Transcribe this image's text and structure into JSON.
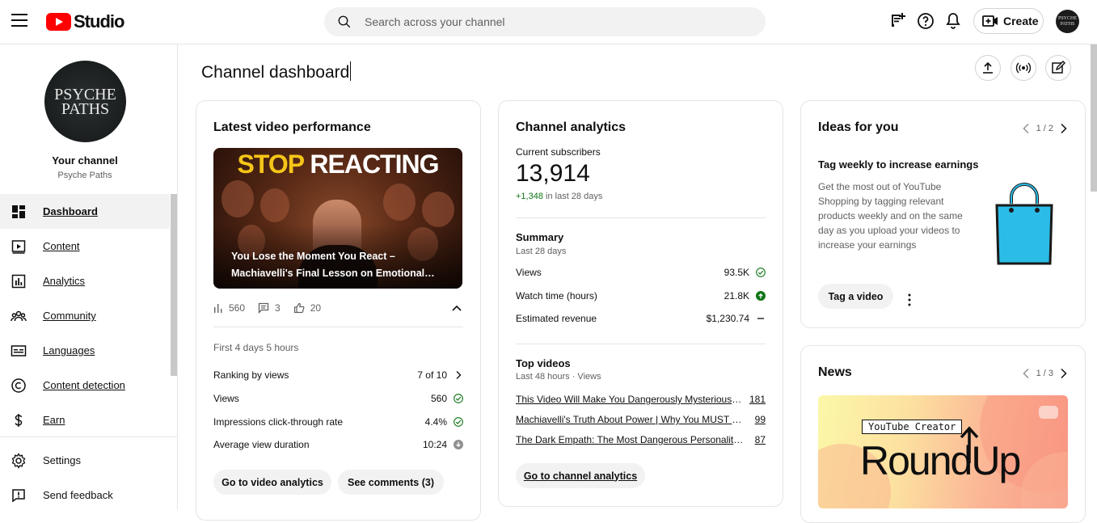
{
  "header": {
    "logo_text": "Studio",
    "search_placeholder": "Search across your channel",
    "create_label": "Create",
    "avatar_text": "PSYCHE PATHS"
  },
  "sidebar": {
    "channel_avatar_line1": "PSYCHE",
    "channel_avatar_line2": "PATHS",
    "channel_title": "Your channel",
    "channel_name": "Psyche Paths",
    "items": [
      {
        "label": "Dashboard",
        "icon": "dashboard-icon"
      },
      {
        "label": "Content",
        "icon": "content-icon"
      },
      {
        "label": "Analytics",
        "icon": "analytics-icon"
      },
      {
        "label": "Community",
        "icon": "community-icon"
      },
      {
        "label": "Languages",
        "icon": "languages-icon"
      },
      {
        "label": "Content detection",
        "icon": "copyright-icon"
      },
      {
        "label": "Earn",
        "icon": "dollar-icon"
      }
    ],
    "bottom_items": [
      {
        "label": "Settings",
        "icon": "gear-icon"
      },
      {
        "label": "Send feedback",
        "icon": "feedback-icon"
      }
    ]
  },
  "page": {
    "title": "Channel dashboard"
  },
  "latest_video": {
    "title": "Latest video performance",
    "thumb_word1": "STOP",
    "thumb_word2": "REACTING",
    "caption": "You Lose the Moment You React – Machiavelli's Final Lesson on Emotional…",
    "views": "560",
    "comments": "3",
    "likes": "20",
    "period": "First 4 days 5 hours",
    "rows": [
      {
        "label": "Ranking by views",
        "value": "7 of 10"
      },
      {
        "label": "Views",
        "value": "560"
      },
      {
        "label": "Impressions click-through rate",
        "value": "4.4%"
      },
      {
        "label": "Average view duration",
        "value": "10:24"
      }
    ],
    "btn_analytics": "Go to video analytics",
    "btn_comments": "See comments (3)"
  },
  "channel_analytics": {
    "title": "Channel analytics",
    "subs_label": "Current subscribers",
    "subs_value": "13,914",
    "subs_delta": "+1,348",
    "subs_delta_suffix": " in last 28 days",
    "summary_title": "Summary",
    "summary_period": "Last 28 days",
    "summary_rows": [
      {
        "label": "Views",
        "value": "93.5K"
      },
      {
        "label": "Watch time (hours)",
        "value": "21.8K"
      },
      {
        "label": "Estimated revenue",
        "value": "$1,230.74"
      }
    ],
    "top_title": "Top videos",
    "top_period": "Last 48 hours · Views",
    "top_videos": [
      {
        "title": "This Video Will Make You Dangerously Mysterious — …",
        "views": "181"
      },
      {
        "title": "Machiavelli's Truth About Power | Why You MUST Be…",
        "views": "99"
      },
      {
        "title": "The Dark Empath: The Most Dangerous Personality T…",
        "views": "87"
      }
    ],
    "btn": "Go to channel analytics"
  },
  "ideas": {
    "title": "Ideas for you",
    "pager": "1 / 2",
    "idea_title": "Tag weekly to increase earnings",
    "idea_text": "Get the most out of YouTube Shopping by tagging relevant products weekly and on the same day as you upload your videos to increase your earnings",
    "btn": "Tag a video"
  },
  "news": {
    "title": "News",
    "pager": "1 / 3",
    "tag": "YouTube Creator",
    "big": "RoundUp"
  },
  "colors": {
    "accent_red": "#ff0000",
    "success_green": "#107516",
    "bag_blue": "#2bbde8",
    "thumb_yellow": "#f5c518"
  }
}
